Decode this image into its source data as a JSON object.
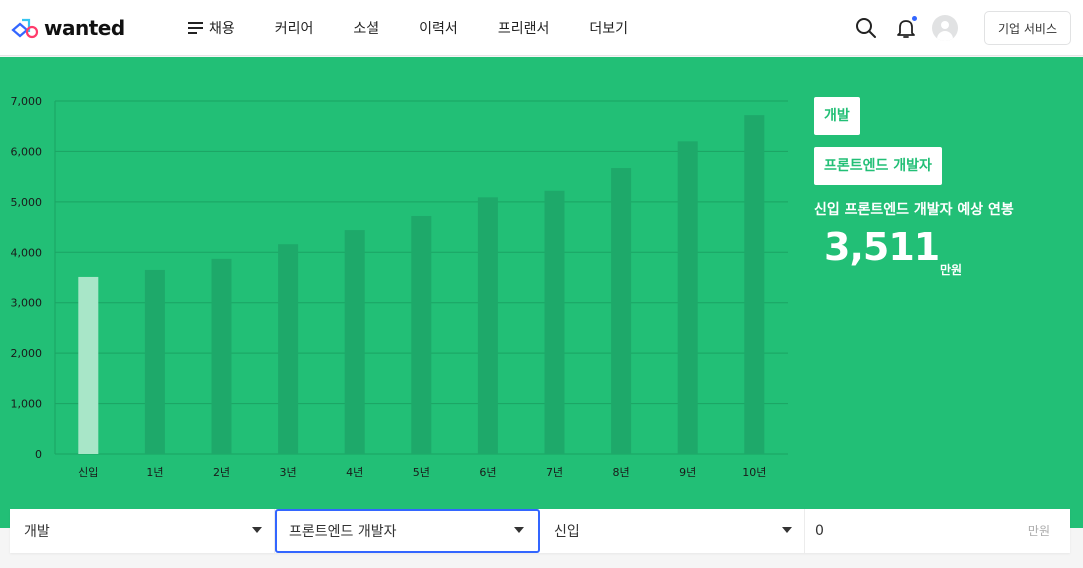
{
  "header": {
    "logo_text": "wanted",
    "nav": [
      {
        "label": "채용"
      },
      {
        "label": "커리어"
      },
      {
        "label": "소셜"
      },
      {
        "label": "이력서"
      },
      {
        "label": "프리랜서"
      },
      {
        "label": "더보기"
      }
    ],
    "business_button": "기업 서비스",
    "notification_dot_color": "#3366ff"
  },
  "side": {
    "tag_category": "개발",
    "tag_job": "프론트엔드 개발자",
    "subtitle": "신입 프론트엔드 개발자 예상 연봉",
    "salary": "3,511",
    "unit": "만원"
  },
  "filters": {
    "category": "개발",
    "job": "프론트엔드 개발자",
    "experience": "신입",
    "salary_input": "0",
    "salary_unit": "만원"
  },
  "colors": {
    "accent": "#22bf76",
    "bar": "#1ea96a",
    "bar_highlight": "#a8e6c8",
    "active_border": "#3366ff"
  },
  "chart_data": {
    "type": "bar",
    "categories": [
      "신입",
      "1년",
      "2년",
      "3년",
      "4년",
      "5년",
      "6년",
      "7년",
      "8년",
      "9년",
      "10년"
    ],
    "values": [
      3511,
      3650,
      3870,
      4160,
      4440,
      4720,
      5090,
      5220,
      5670,
      6200,
      6720
    ],
    "highlight_index": 0,
    "ylim": [
      0,
      7000
    ],
    "yticks": [
      "0",
      "1,000",
      "2,000",
      "3,000",
      "4,000",
      "5,000",
      "6,000",
      "7,000"
    ],
    "grid": true,
    "title": "",
    "xlabel": "",
    "ylabel": ""
  }
}
